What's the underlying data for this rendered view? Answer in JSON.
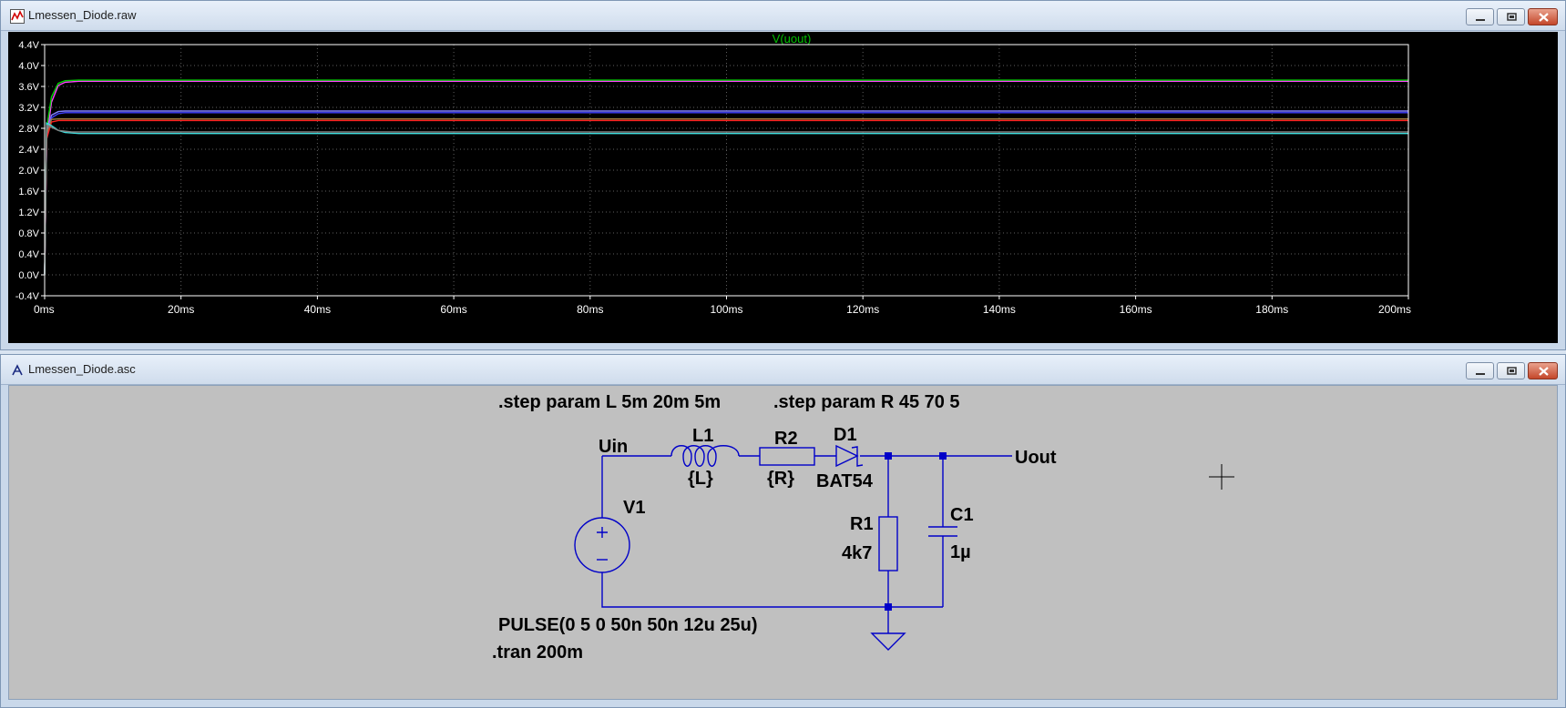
{
  "waveform_window": {
    "title": "Lmessen_Diode.raw",
    "icon": "waveform-icon",
    "buttons": [
      "minimize-button",
      "maximize-button",
      "close-button"
    ]
  },
  "chart_data": {
    "type": "line",
    "title": "V(uout)",
    "title_color": "#00c000",
    "xlabel": "",
    "ylabel": "",
    "xlim": [
      0,
      200
    ],
    "ylim": [
      -0.4,
      4.4
    ],
    "x_ticks": [
      "0ms",
      "20ms",
      "40ms",
      "60ms",
      "80ms",
      "100ms",
      "120ms",
      "140ms",
      "160ms",
      "180ms",
      "200ms"
    ],
    "y_ticks": [
      "-0.4V",
      "0.0V",
      "0.4V",
      "0.8V",
      "1.2V",
      "1.6V",
      "2.0V",
      "2.4V",
      "2.8V",
      "3.2V",
      "3.6V",
      "4.0V",
      "4.4V"
    ],
    "grid": true,
    "background": "#000000",
    "series": [
      {
        "color": "#ff40ff",
        "values": [
          [
            0,
            0
          ],
          [
            0.3,
            2.6
          ],
          [
            1,
            3.3
          ],
          [
            2,
            3.62
          ],
          [
            3,
            3.68
          ],
          [
            5,
            3.7
          ],
          [
            200,
            3.7
          ]
        ]
      },
      {
        "color": "#00d000",
        "values": [
          [
            0,
            0
          ],
          [
            0.3,
            2.8
          ],
          [
            1,
            3.4
          ],
          [
            2,
            3.66
          ],
          [
            3,
            3.71
          ],
          [
            5,
            3.72
          ],
          [
            200,
            3.72
          ]
        ]
      },
      {
        "color": "#8080ff",
        "values": [
          [
            0,
            0
          ],
          [
            0.3,
            2.7
          ],
          [
            1,
            3.05
          ],
          [
            2,
            3.12
          ],
          [
            3,
            3.13
          ],
          [
            200,
            3.13
          ]
        ]
      },
      {
        "color": "#4040ff",
        "values": [
          [
            0,
            0
          ],
          [
            0.3,
            2.6
          ],
          [
            1,
            3.0
          ],
          [
            2,
            3.08
          ],
          [
            3,
            3.1
          ],
          [
            200,
            3.1
          ]
        ]
      },
      {
        "color": "#ff2020",
        "values": [
          [
            0,
            0
          ],
          [
            0.3,
            2.6
          ],
          [
            1,
            2.92
          ],
          [
            2,
            2.95
          ],
          [
            200,
            2.95
          ]
        ]
      },
      {
        "color": "#a08040",
        "values": [
          [
            0,
            0
          ],
          [
            0.3,
            2.7
          ],
          [
            1,
            2.97
          ],
          [
            2,
            2.98
          ],
          [
            200,
            2.98
          ]
        ]
      },
      {
        "color": "#40e0e0",
        "values": [
          [
            0,
            0
          ],
          [
            0.3,
            2.9
          ],
          [
            1,
            2.85
          ],
          [
            2,
            2.76
          ],
          [
            3,
            2.72
          ],
          [
            5,
            2.7
          ],
          [
            200,
            2.7
          ]
        ]
      },
      {
        "color": "#808080",
        "values": [
          [
            0,
            0
          ],
          [
            0.3,
            2.85
          ],
          [
            1,
            2.82
          ],
          [
            2,
            2.76
          ],
          [
            4,
            2.73
          ],
          [
            200,
            2.73
          ]
        ]
      }
    ]
  },
  "schematic_window": {
    "title": "Lmessen_Diode.asc",
    "icon": "schematic-icon",
    "buttons": [
      "minimize-button",
      "maximize-button",
      "close-button"
    ]
  },
  "schematic": {
    "directives": {
      "step_l": ".step param L 5m 20m 5m",
      "step_r": ".step param R 45 70 5",
      "tran": ".tran 200m"
    },
    "source": {
      "name": "V1",
      "value": "PULSE(0 5 0 50n 50n 12u 25u)"
    },
    "nets": {
      "in": "Uin",
      "out": "Uout"
    },
    "inductor": {
      "name": "L1",
      "value": "{L}"
    },
    "resistor_series": {
      "name": "R2",
      "value": "{R}"
    },
    "diode": {
      "name": "D1",
      "value": "BAT54"
    },
    "resistor_load": {
      "name": "R1",
      "value": "4k7"
    },
    "capacitor": {
      "name": "C1",
      "value": "1µ"
    },
    "wire_color": "#0000c8",
    "label_color": "#000000"
  }
}
